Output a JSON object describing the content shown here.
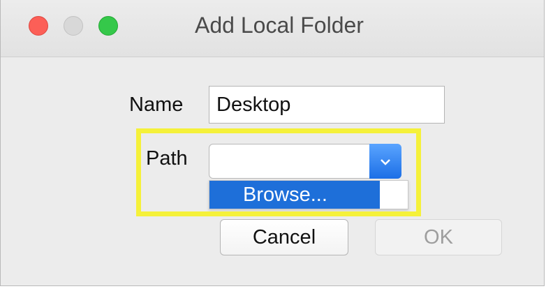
{
  "window": {
    "title": "Add Local Folder"
  },
  "form": {
    "name_label": "Name",
    "name_value": "Desktop",
    "path_label": "Path",
    "path_value": "",
    "path_menu_item": "Browse..."
  },
  "buttons": {
    "cancel_label": "Cancel",
    "ok_label": "OK"
  },
  "colors": {
    "highlight": "#f5f13a",
    "accent": "#1e6fd9"
  },
  "icons": {
    "close": "close-button",
    "minimize": "minimize-button",
    "zoom": "zoom-button",
    "popup_arrow": "chevron-down-icon"
  }
}
